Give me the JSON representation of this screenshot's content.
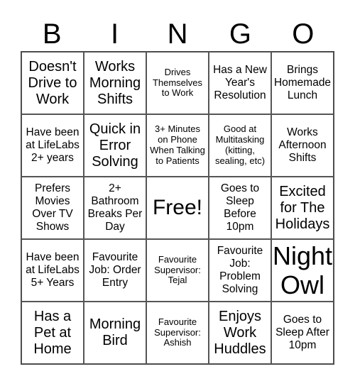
{
  "header": [
    "B",
    "I",
    "N",
    "G",
    "O"
  ],
  "cells": [
    {
      "text": "Doesn't Drive to Work",
      "size": "s20"
    },
    {
      "text": "Works Morning Shifts",
      "size": "s20"
    },
    {
      "text": "Drives Themselves to Work",
      "size": "s13"
    },
    {
      "text": "Has a New Year's Resolution",
      "size": "s15"
    },
    {
      "text": "Brings Homemade Lunch",
      "size": "s15"
    },
    {
      "text": "Have been at LifeLabs 2+ years",
      "size": "s15"
    },
    {
      "text": "Quick in Error Solving",
      "size": "s20"
    },
    {
      "text": "3+ Minutes on Phone When Talking to Patients",
      "size": "s13"
    },
    {
      "text": "Good at Multitasking (kitting, sealing, etc)",
      "size": "s13"
    },
    {
      "text": "Works Afternoon Shifts",
      "size": "s15"
    },
    {
      "text": "Prefers Movies Over TV Shows",
      "size": "s15"
    },
    {
      "text": "2+ Bathroom Breaks Per Day",
      "size": "s15"
    },
    {
      "text": "Free!",
      "size": "s30"
    },
    {
      "text": "Goes to Sleep Before 10pm",
      "size": "s15"
    },
    {
      "text": "Excited for The Holidays",
      "size": "s20"
    },
    {
      "text": "Have been at LifeLabs 5+ Years",
      "size": "s15"
    },
    {
      "text": "Favourite Job: Order Entry",
      "size": "s15"
    },
    {
      "text": "Favourite Supervisor: Tejal",
      "size": "s13"
    },
    {
      "text": "Favourite Job: Problem Solving",
      "size": "s15"
    },
    {
      "text": "Night Owl",
      "size": "s35"
    },
    {
      "text": "Has a Pet at Home",
      "size": "s20"
    },
    {
      "text": "Morning Bird",
      "size": "s20"
    },
    {
      "text": "Favourite Supervisor: Ashish",
      "size": "s13"
    },
    {
      "text": "Enjoys Work Huddles",
      "size": "s20"
    },
    {
      "text": "Goes to Sleep After 10pm",
      "size": "s15"
    }
  ]
}
